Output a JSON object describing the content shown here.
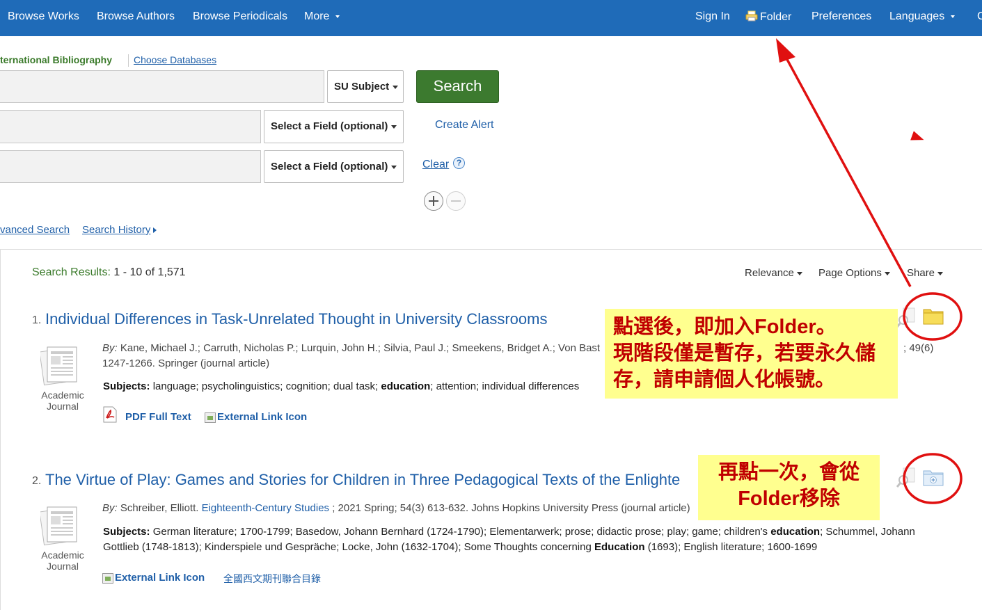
{
  "nav": {
    "browse_works": "Browse Works",
    "browse_authors": "Browse Authors",
    "browse_periodicals": "Browse Periodicals",
    "more": "More",
    "sign_in": "Sign In",
    "folder": "Folder",
    "preferences": "Preferences",
    "languages": "Languages",
    "cut_item": "C"
  },
  "search": {
    "database_label": "ternational Bibliography",
    "choose_databases": "Choose Databases",
    "row1_field": "SU Subject",
    "row2_field": "Select a Field (optional)",
    "row3_field": "Select a Field (optional)",
    "search_button": "Search",
    "create_alert": "Create Alert",
    "clear": "Clear",
    "help": "?",
    "advanced_search": "vanced Search",
    "search_history": "Search History"
  },
  "results": {
    "label": "Search Results:",
    "range": "1 - 10 of 1,571",
    "sort_relevance": "Relevance",
    "page_options": "Page Options",
    "share": "Share",
    "items": [
      {
        "num": "1.",
        "title": "Individual Differences in Task-Unrelated Thought in University Classrooms",
        "by_label": "By:",
        "authors": "Kane, Michael J.; Carruth, Nicholas P.; Lurquin, John H.; Silvia, Paul J.; Smeekens, Bridget A.; Von Bast",
        "meta_tail": "; 49(6)",
        "meta_line2": "1247-1266. Springer (journal article)",
        "subjects_label": "Subjects:",
        "subjects_pre": "language; psycholinguistics; cognition; dual task;",
        "subjects_bold": "education",
        "subjects_post": "; attention; individual differences",
        "type_line1": "Academic",
        "type_line2": "Journal",
        "link_pdf": "PDF Full Text",
        "link_external": "External Link Icon"
      },
      {
        "num": "2.",
        "title": "The Virtue of Play: Games and Stories for Children in Three Pedagogical Texts of the Enlighte",
        "by_label": "By:",
        "authors": "Schreiber, Elliott.",
        "periodical": "Eighteenth-Century Studies",
        "meta_rest": "; 2021 Spring; 54(3) 613-632. Johns Hopkins University Press (journal article)",
        "subjects_label": "Subjects:",
        "subjects_a": "German literature; 1700-1799; Basedow, Johann Bernhard (1724-1790); Elementarwerk; prose; didactic prose; play; game; children's",
        "subjects_b1": "education",
        "subjects_c": "; Schummel, Johann",
        "subjects_d": "Gottlieb (1748-1813); Kinderspiele und Gespräche; Locke, John (1632-1704); Some Thoughts concerning",
        "subjects_b2": "Education",
        "subjects_e": "(1693); English literature; 1600-1699",
        "type_line1": "Academic",
        "type_line2": "Journal",
        "link_external": "External Link Icon",
        "link_catalog": "全國西文期刊聯合目錄"
      }
    ]
  },
  "annotations": {
    "note1_line1": "點選後，即加入Folder。",
    "note1_line2": "現階段僅是暫存，若要永久儲",
    "note1_line3": "存，請申請個人化帳號。",
    "note2_line1": "再點一次，會從",
    "note2_line2": "Folder移除",
    "color_red": "#e01010",
    "note_bg": "#ffff8f"
  }
}
